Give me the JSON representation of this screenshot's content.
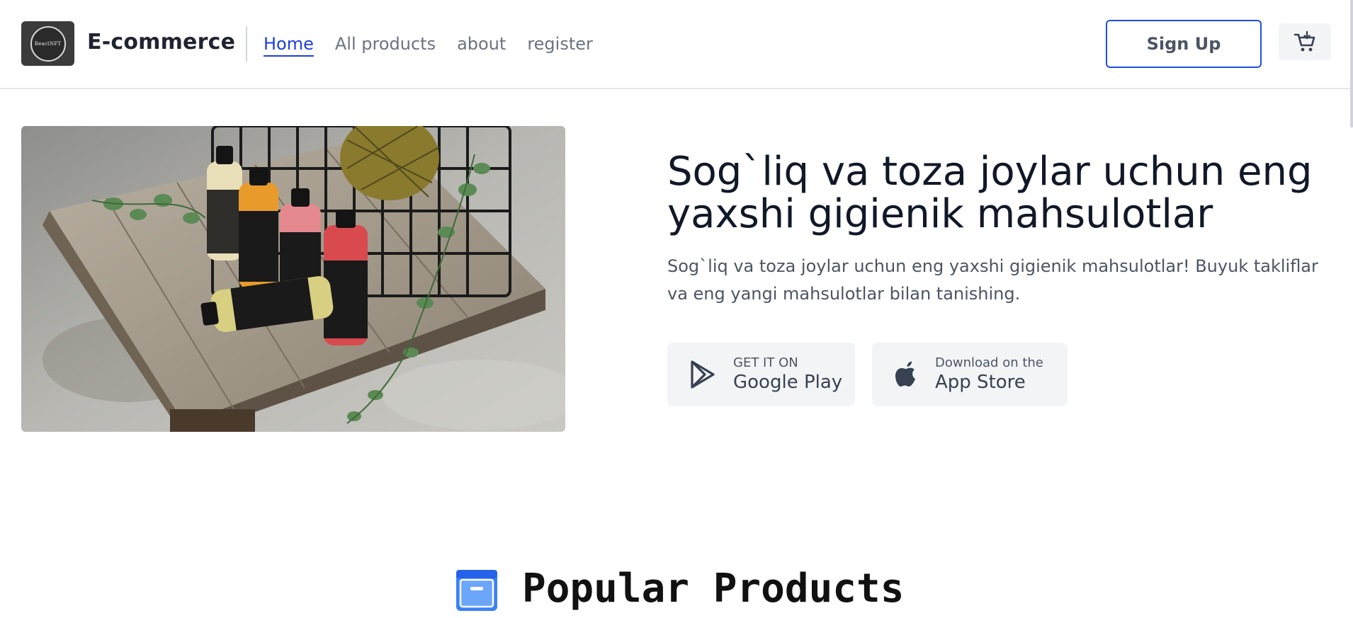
{
  "header": {
    "logo_text": "ReactNFT",
    "brand": "E-commerce",
    "nav": [
      {
        "label": "Home",
        "active": true
      },
      {
        "label": "All products",
        "active": false
      },
      {
        "label": "about",
        "active": false
      },
      {
        "label": "register",
        "active": false
      }
    ],
    "signup_label": "Sign Up",
    "cart_icon": "cart-icon"
  },
  "hero": {
    "image_icon": "product-photo",
    "title": "Sog`liq va toza joylar uchun eng yaxshi gigienik mahsulotlar",
    "description": "Sog`liq va toza joylar uchun eng yaxshi gigienik mahsulotlar! Buyuk takliflar va eng yangi mahsulotlar bilan tanishing.",
    "google_play": {
      "small": "GET IT ON",
      "big": "Google Play",
      "icon": "google-play-icon"
    },
    "app_store": {
      "small": "Download on the",
      "big": "App Store",
      "icon": "apple-icon"
    }
  },
  "popular": {
    "title": "Popular Products",
    "icon": "archive-box-icon"
  },
  "colors": {
    "accent": "#1d3fe0",
    "store_bg": "#f3f4f6",
    "popular_icon": "#3b82f6"
  }
}
